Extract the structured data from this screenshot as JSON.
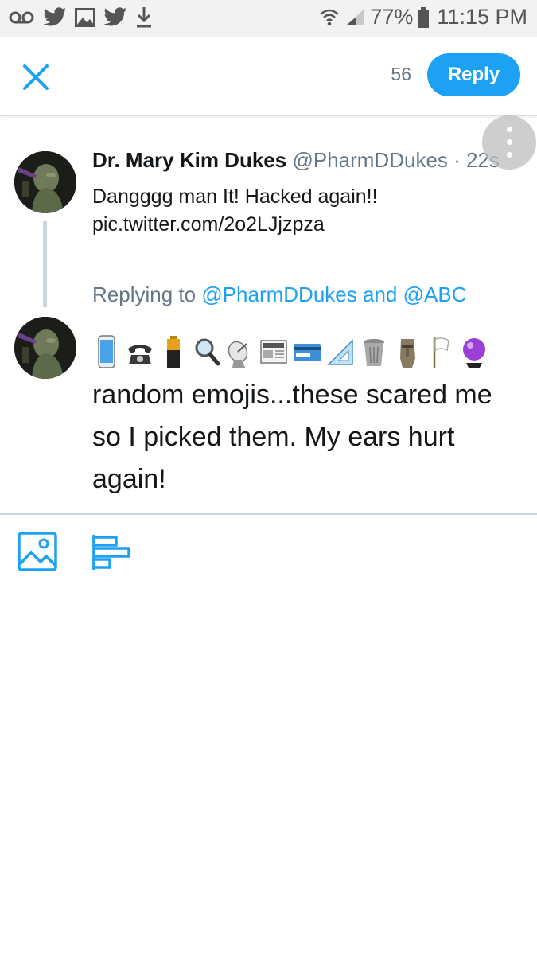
{
  "status_bar": {
    "battery": "77%",
    "time": "11:15 PM"
  },
  "header": {
    "char_count": "56",
    "reply_label": "Reply"
  },
  "tweet": {
    "author_name": "Dr. Mary Kim Dukes",
    "author_handle": "@PharmDDukes",
    "separator": "·",
    "timestamp": "22s",
    "text_line1": "Dangggg man It!  Hacked again!!",
    "text_line2": "pic.twitter.com/2o2LJjzpza"
  },
  "reply": {
    "replying_to_prefix": "Replying to",
    "mention_1": "@PharmDDukes",
    "conjunction": "and",
    "mention_2": "@ABC",
    "emojis": [
      "mobile-phone",
      "telephone",
      "battery",
      "magnifying-glass",
      "satellite-antenna",
      "newspaper",
      "credit-card",
      "triangular-ruler",
      "wastebasket",
      "moai",
      "white-flag",
      "crystal-ball"
    ],
    "compose_text": "random emojis...these scared me so I picked them.  My ears hurt again!"
  },
  "toolbar": {
    "icons": [
      "image-icon",
      "poll-icon"
    ]
  },
  "colors": {
    "accent": "#1da1f2",
    "secondary_text": "#657786",
    "divider": "#ccd6dd"
  }
}
